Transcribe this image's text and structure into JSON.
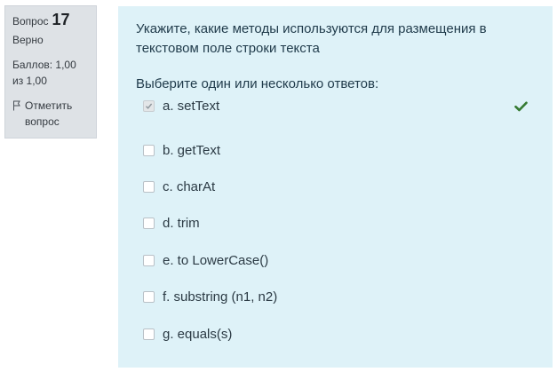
{
  "info": {
    "question_label": "Вопрос",
    "question_number": "17",
    "state": "Верно",
    "grade": "Баллов: 1,00 из 1,00",
    "flag_label": "Отметить вопрос"
  },
  "question": {
    "text": "Укажите, какие методы используются для размещения в текстовом поле строки текста",
    "prompt": "Выберите один или несколько ответов:",
    "answers": [
      {
        "label": "a. setText",
        "checked": true,
        "correct": true
      },
      {
        "label": "b. getText",
        "checked": false
      },
      {
        "label": "c. charAt",
        "checked": false
      },
      {
        "label": "d. trim",
        "checked": false
      },
      {
        "label": "e. to LowerCase()",
        "checked": false
      },
      {
        "label": "f. substring (n1, n2)",
        "checked": false
      },
      {
        "label": "g. equals(s)",
        "checked": false
      }
    ]
  },
  "colors": {
    "info_bg": "#dee2e6",
    "formulation_bg": "#def2f8",
    "correct_tick": "#357a32"
  },
  "icons": {
    "flag": "flag-icon",
    "correct": "check-icon"
  }
}
